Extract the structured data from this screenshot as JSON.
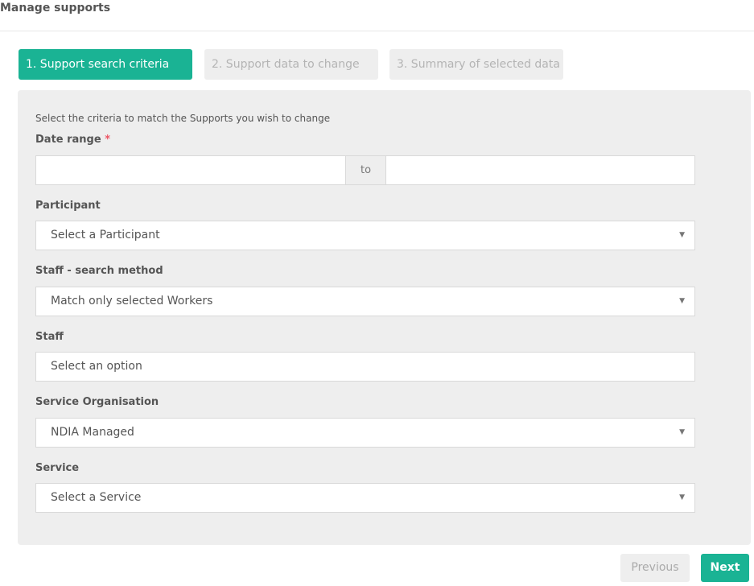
{
  "page": {
    "title": "Manage supports"
  },
  "steps": [
    {
      "label": "1. Support search criteria"
    },
    {
      "label": "2. Support data to change"
    },
    {
      "label": "3. Summary of selected data"
    }
  ],
  "form": {
    "instruction": "Select the criteria to match the Supports you wish to change",
    "date_range": {
      "label": "Date range",
      "required_mark": "*",
      "separator": "to",
      "from_value": "",
      "to_value": ""
    },
    "participant": {
      "label": "Participant",
      "value": "Select a Participant"
    },
    "staff_search_method": {
      "label": "Staff - search method",
      "value": "Match only selected Workers"
    },
    "staff": {
      "label": "Staff",
      "value": "Select an option"
    },
    "service_organisation": {
      "label": "Service Organisation",
      "value": "NDIA Managed"
    },
    "service": {
      "label": "Service",
      "value": "Select a Service"
    }
  },
  "buttons": {
    "previous": "Previous",
    "next": "Next"
  },
  "icons": {
    "dropdown": "caret-down-icon",
    "dropdown_glyph": "▼"
  },
  "colors": {
    "accent": "#1ab394",
    "required": "#ed5565",
    "panel": "#eeeeee"
  }
}
